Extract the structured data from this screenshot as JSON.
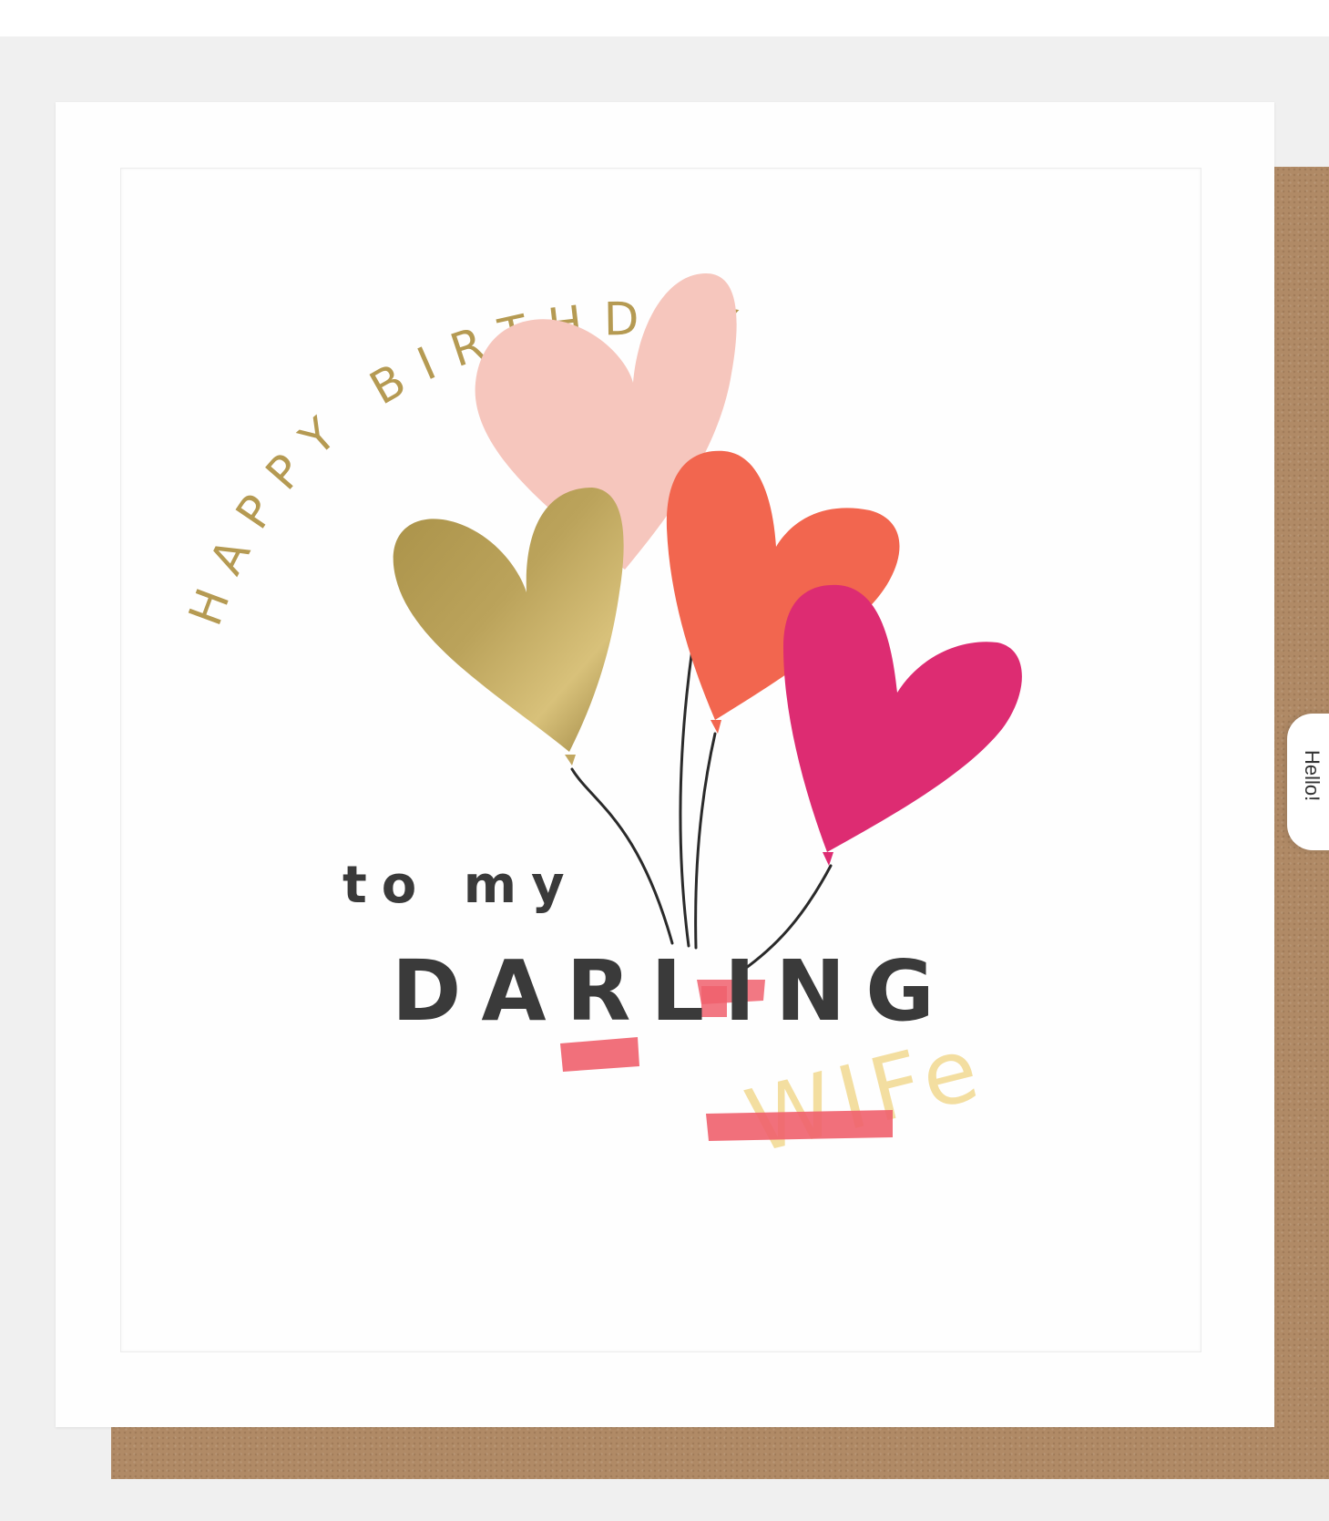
{
  "card": {
    "greeting_arc": "HAPPY BIRTHDAY",
    "line_top": "to my",
    "line_main": "DARLING",
    "handwritten": "WIFe",
    "handwritten_color": "#f3dea0"
  },
  "side_tab": {
    "label": "Hello!"
  },
  "colors": {
    "gold": "#b59a52",
    "pink_light": "#f6c6bd",
    "coral": "#f2664f",
    "magenta": "#dd2c72",
    "text_dark": "#3a3a3a",
    "strike_red": "#f0606d",
    "envelope": "#b08a66"
  },
  "icons": [
    "heart-balloon-gold-icon",
    "heart-balloon-pink-icon",
    "heart-balloon-coral-icon",
    "heart-balloon-magenta-icon"
  ]
}
